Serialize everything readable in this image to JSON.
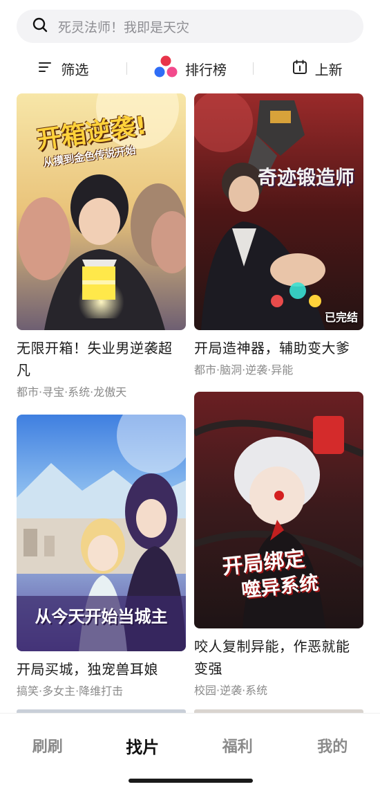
{
  "search": {
    "placeholder": "死灵法师！我即是天灾"
  },
  "toolbar": {
    "filter": "筛选",
    "ranking": "排行榜",
    "new": "上新"
  },
  "cards": [
    {
      "cover_text": "开箱逆袭!",
      "cover_subtext": "从摸到金色传说开始",
      "title": "无限开箱！失业男逆袭超凡",
      "tags": "都市·寻宝·系统·龙傲天"
    },
    {
      "cover_text": "奇迹锻造师",
      "cover_subtext": "",
      "badge": "已完结",
      "title": "开局造神器，辅助变大爹",
      "tags": "都市·脑洞·逆袭·异能"
    },
    {
      "cover_text": "从今天开始当城主",
      "cover_subtext": "",
      "title": "开局买城，独宠兽耳娘",
      "tags": "搞笑·多女主·降维打击"
    },
    {
      "cover_text": "开局绑定",
      "cover_subtext": "噬异系统",
      "title": "咬人复制异能，作恶就能变强",
      "tags": "校园·逆袭·系统"
    }
  ],
  "nav": {
    "items": [
      "刷刷",
      "找片",
      "福利",
      "我的"
    ],
    "active_index": 1
  },
  "colors": {
    "accent_red": "#e8344a",
    "accent_blue": "#2f6df6",
    "accent_pink": "#f24a8c"
  }
}
